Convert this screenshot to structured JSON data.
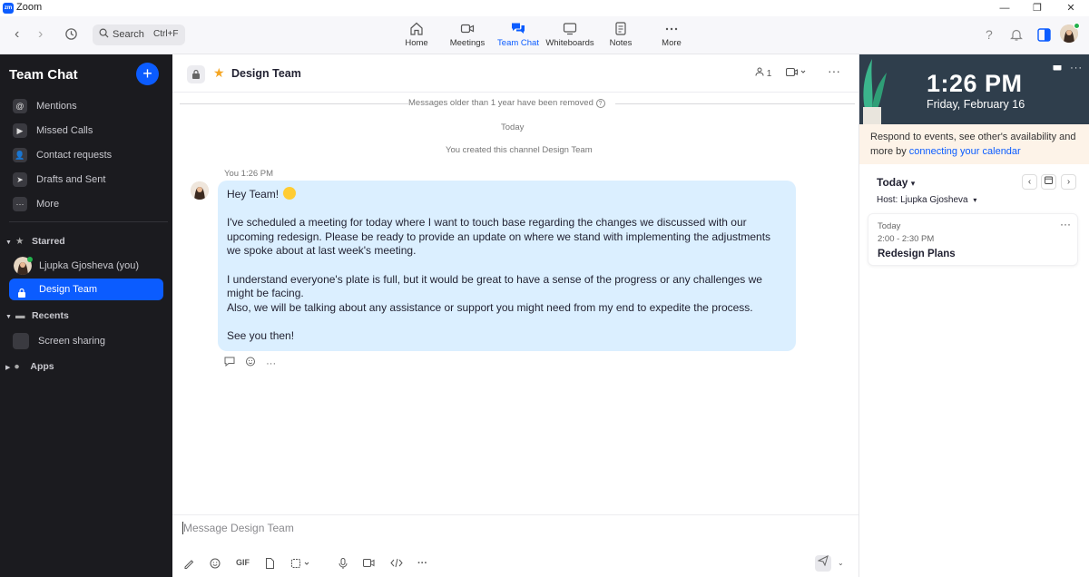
{
  "window": {
    "app_name": "Zoom",
    "controls": [
      "—",
      "❐",
      "✕"
    ]
  },
  "topnav": {
    "search_label": "Search",
    "search_shortcut": "Ctrl+F",
    "tabs": [
      {
        "label": "Home",
        "icon": "home-icon"
      },
      {
        "label": "Meetings",
        "icon": "video-camera-icon"
      },
      {
        "label": "Team Chat",
        "icon": "chat-bubbles-icon",
        "active": true
      },
      {
        "label": "Whiteboards",
        "icon": "whiteboard-icon"
      },
      {
        "label": "Notes",
        "icon": "notes-icon"
      },
      {
        "label": "More",
        "icon": "ellipsis-icon"
      }
    ],
    "help_glyph": "?"
  },
  "sidebar": {
    "title": "Team Chat",
    "items": [
      {
        "label": "Mentions",
        "icon": "at-sign-icon",
        "glyph": "@"
      },
      {
        "label": "Missed Calls",
        "icon": "video-icon",
        "glyph": "▶"
      },
      {
        "label": "Contact requests",
        "icon": "contact-icon",
        "glyph": "👤"
      },
      {
        "label": "Drafts and Sent",
        "icon": "send-icon",
        "glyph": "➤"
      },
      {
        "label": "More",
        "icon": "more-icon",
        "glyph": "···"
      }
    ],
    "sections": {
      "starred": "Starred",
      "recents": "Recents",
      "apps": "Apps"
    },
    "starred_items": [
      {
        "label": "Ljupka Gjosheva (you)"
      },
      {
        "label": "Design Team",
        "selected": true
      }
    ],
    "recent_items": [
      {
        "label": "Screen sharing"
      }
    ]
  },
  "chat": {
    "title": "Design Team",
    "member_count": "1",
    "notice_old": "Messages older than 1 year have been removed",
    "date_separator": "Today",
    "created_notice": "You created this channel Design Team",
    "message": {
      "sender": "You",
      "time": "1:26 PM",
      "greeting": "Hey Team!",
      "para1": "I've scheduled a meeting for today where I want to touch base regarding the changes we discussed with our upcoming redesign. Please be ready to provide an update on where we stand with implementing the adjustments we spoke about at last week's meeting.",
      "para2a": "I understand everyone's plate is full, but it would be great to have a sense of the progress or any challenges we might be facing.",
      "para2b": "Also, we will be talking about any assistance or support you might need from my end to expedite the process.",
      "closing": "See you then!"
    },
    "composer_placeholder": "Message Design Team",
    "composer_gif": "GIF"
  },
  "calendar": {
    "time": "1:26 PM",
    "date": "Friday, February 16",
    "notice_text": "Respond to events, see other's availability and more by ",
    "notice_link": "connecting your calendar",
    "today_label": "Today",
    "host": "Host:  Ljupka Gjosheva",
    "event": {
      "day": "Today",
      "time": "2:00 - 2:30 PM",
      "name": "Redesign Plans"
    }
  },
  "colors": {
    "accent": "#0b5cff",
    "sidebar_bg": "#1b1b1f",
    "bubble": "#dbefff",
    "calendar_header": "#2f3e4c"
  }
}
